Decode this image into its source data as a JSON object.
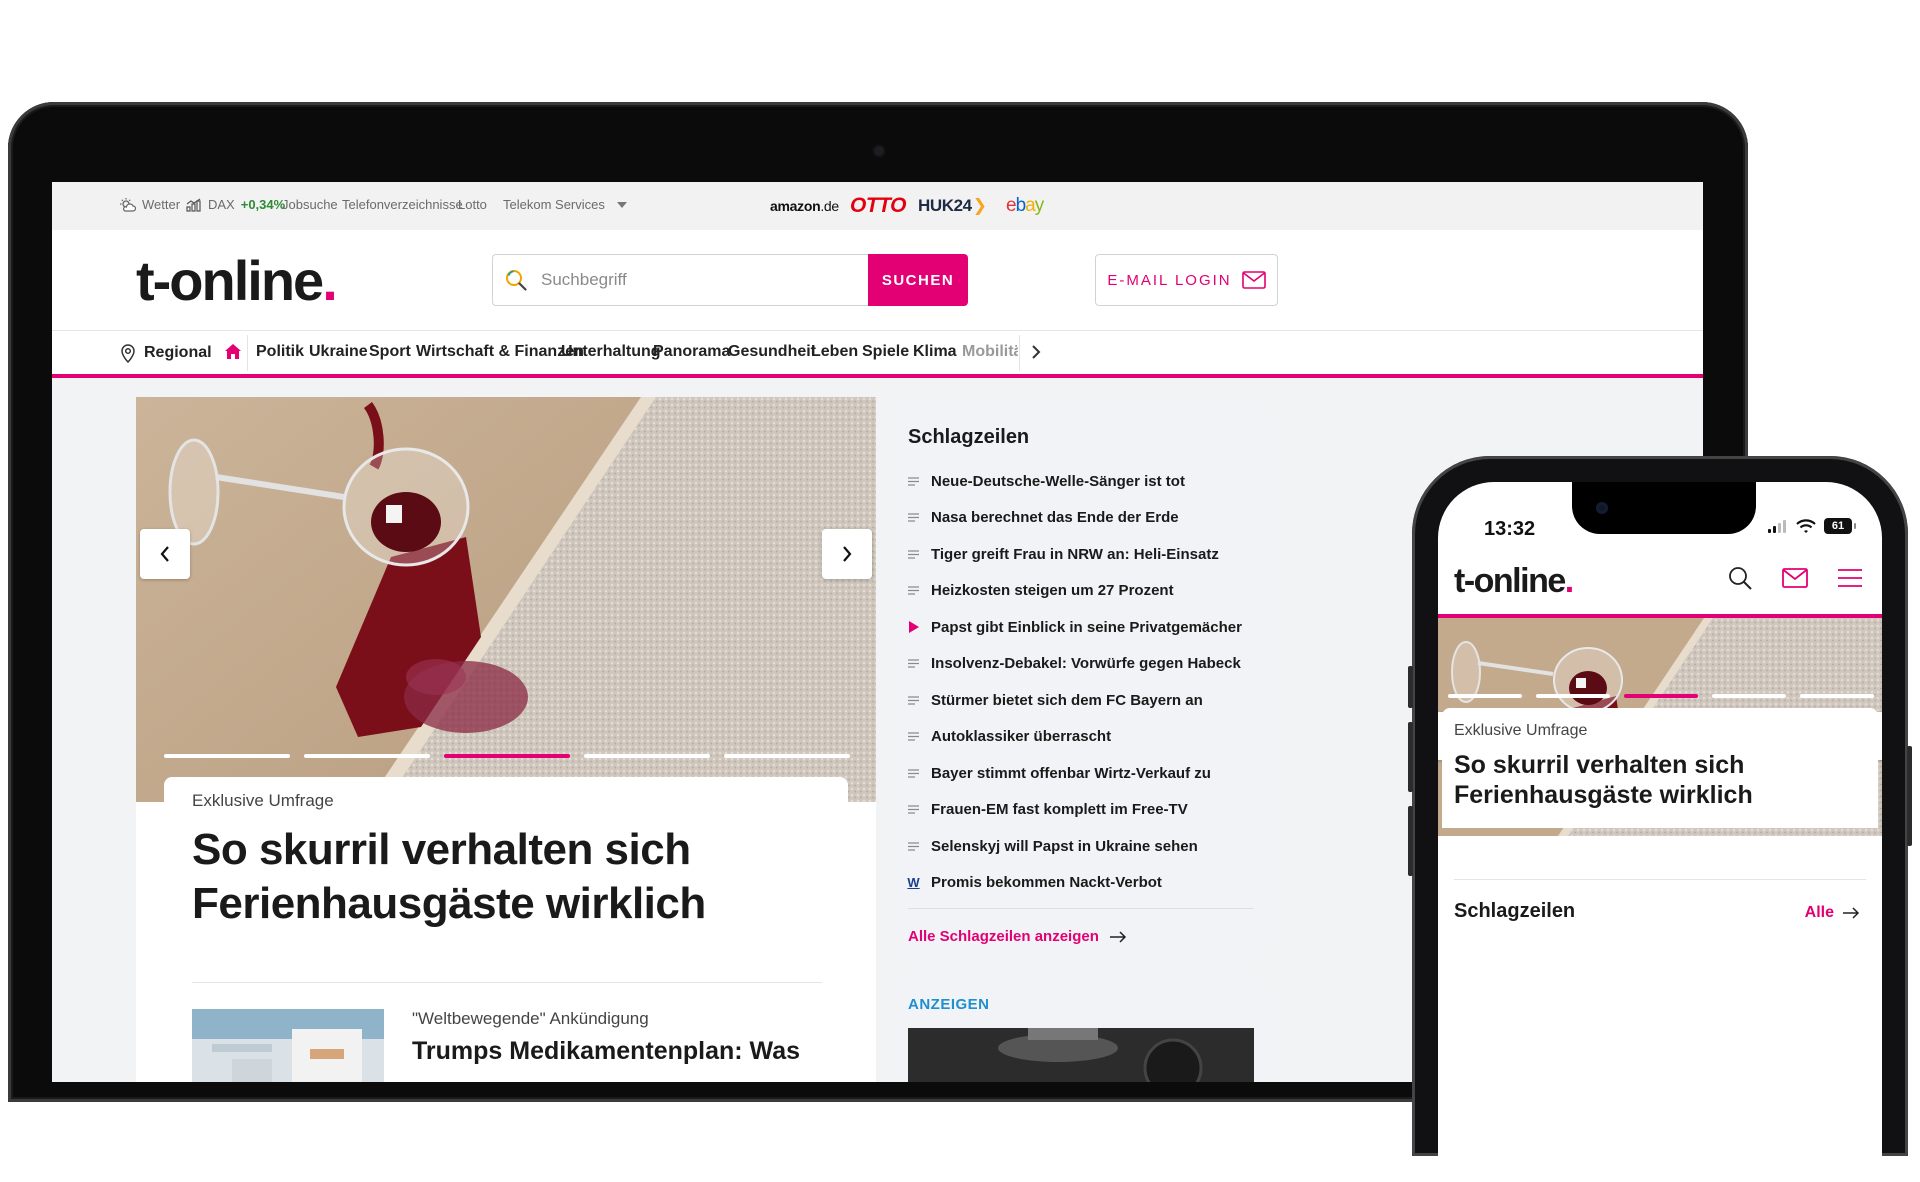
{
  "topbar": {
    "weather": "Wetter",
    "dax_label": "DAX",
    "dax_value": "+0,34%",
    "jobs": "Jobsuche",
    "phonebook": "Telefonverzeichnisse",
    "lotto": "Lotto",
    "telekom_services": "Telekom Services",
    "partners": {
      "amazon": "amazon",
      "amazon_tld": ".de",
      "otto": "OTTO",
      "huk": "HUK24",
      "ebay_e": "e",
      "ebay_b": "b",
      "ebay_a": "a",
      "ebay_y": "y"
    }
  },
  "header": {
    "logo": "t-online",
    "logo_dot": ".",
    "search_placeholder": "Suchbegriff",
    "search_button": "SUCHEN",
    "email_login": "E-MAIL LOGIN"
  },
  "nav": {
    "regional": "Regional",
    "items": [
      "Politik",
      "Ukraine",
      "Sport",
      "Wirtschaft & Finanzen",
      "Unterhaltung",
      "Panorama",
      "Gesundheit",
      "Leben",
      "Spiele",
      "Klima",
      "Mobilität"
    ]
  },
  "hero": {
    "kicker": "Exklusive Umfrage",
    "headline_line1": "So skurril verhalten sich",
    "headline_line2": "Ferienhausgäste wirklich",
    "active_slide": 3,
    "slide_count": 5
  },
  "teaser": {
    "kicker": "\"Weltbewegende\" Ankündigung",
    "headline": "Trumps Medikamentenplan: Was"
  },
  "schlagzeilen": {
    "title": "Schlagzeilen",
    "items": [
      {
        "text": "Neue-Deutsche-Welle-Sänger ist tot",
        "icon": "lines-icon"
      },
      {
        "text": "Nasa berechnet das Ende der Erde",
        "icon": "lines-icon"
      },
      {
        "text": "Tiger greift Frau in NRW an: Heli-Einsatz",
        "icon": "lines-icon"
      },
      {
        "text": "Heizkosten steigen um 27 Prozent",
        "icon": "lines-icon"
      },
      {
        "text": "Papst gibt Einblick in seine Privatgemächer",
        "icon": "play-icon"
      },
      {
        "text": "Insolvenz-Debakel: Vorwürfe gegen Habeck",
        "icon": "lines-icon"
      },
      {
        "text": "Stürmer bietet sich dem FC Bayern an",
        "icon": "lines-icon"
      },
      {
        "text": "Autoklassiker überrascht",
        "icon": "lines-icon"
      },
      {
        "text": "Bayer stimmt offenbar Wirtz-Verkauf zu",
        "icon": "lines-icon"
      },
      {
        "text": "Frauen-EM fast komplett im Free-TV",
        "icon": "lines-icon"
      },
      {
        "text": "Selenskyj will Papst in Ukraine sehen",
        "icon": "lines-icon"
      },
      {
        "text": "Promis bekommen Nackt-Verbot",
        "icon": "w-icon",
        "icon_text": "W"
      }
    ],
    "all_link": "Alle Schlagzeilen anzeigen"
  },
  "ads": {
    "label": "ANZEIGEN"
  },
  "phone": {
    "time": "13:32",
    "battery": "61",
    "logo": "t-online",
    "logo_dot": ".",
    "kicker": "Exklusive Umfrage",
    "headline_line1": "So skurril verhalten sich",
    "headline_line2": "Ferienhausgäste wirklich",
    "schlagzeilen": "Schlagzeilen",
    "all": "Alle"
  },
  "colors": {
    "brand_magenta": "#e20074",
    "dax_green": "#2f8a35",
    "ads_blue": "#1e8fcf"
  }
}
